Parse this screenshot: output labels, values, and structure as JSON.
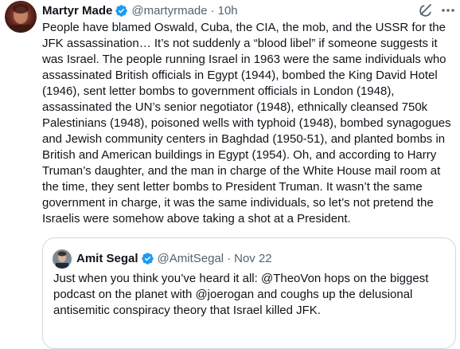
{
  "tweet": {
    "author": {
      "display_name": "Martyr Made",
      "handle": "@martyrmade",
      "separator": "·",
      "time": "10h"
    },
    "text": "People have blamed Oswald, Cuba, the CIA, the mob, and the USSR for the JFK assassination… It’s not suddenly a “blood libel” if someone suggests it was Israel. The people running Israel in 1963 were the same individuals who assassinated British officials in Egypt (1944), bombed the King David Hotel (1946), sent letter bombs to government officials in London (1948), assassinated the UN’s senior negotiator (1948), ethnically cleansed 750k Palestinians (1948), poisoned wells with typhoid (1948), bombed synagogues and Jewish community centers in Baghdad (1950-51), and planted bombs in British and American buildings in Egypt (1954). Oh, and according to Harry Truman’s daughter, and the man in charge of the White House mail room at the time, they sent letter bombs to President Truman. It wasn’t the same government in charge, it was the same individuals, so let’s not pretend the Israelis were somehow above taking a shot at a President.",
    "icons": {
      "grok": "grok-icon",
      "more": "more-icon",
      "verified": "verified-badge-icon"
    }
  },
  "quote": {
    "author": {
      "display_name": "Amit Segal",
      "handle": "@AmitSegal",
      "separator": "·",
      "date": "Nov 22"
    },
    "text": "Just when you think you’ve heard it all: @TheoVon  hops on the biggest podcast on the planet with @joerogan and coughs up the delusional antisemitic conspiracy theory that Israel killed JFK."
  },
  "colors": {
    "text": "#0f1419",
    "secondary": "#536471",
    "verified": "#1d9bf0",
    "border": "#cfd9de"
  }
}
